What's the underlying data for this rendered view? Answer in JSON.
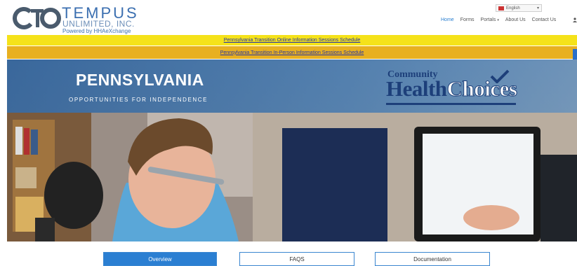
{
  "header": {
    "logo": {
      "mark_text": "CTO",
      "name": "TEMPUS",
      "subname": "UNLIMITED, INC.",
      "powered_by": "Powered by HHAeXchange"
    },
    "language": {
      "selected": "English",
      "icon": "us-flag-icon"
    },
    "nav": [
      {
        "label": "Home",
        "active": true,
        "has_dropdown": false
      },
      {
        "label": "Forms",
        "active": false,
        "has_dropdown": false
      },
      {
        "label": "Portals",
        "active": false,
        "has_dropdown": true
      },
      {
        "label": "About Us",
        "active": false,
        "has_dropdown": false
      },
      {
        "label": "Contact Us",
        "active": false,
        "has_dropdown": false
      }
    ],
    "user_icon": "user-icon"
  },
  "banners": [
    {
      "text": "Pennsylvania Transition Online Information Sessions Schedule",
      "color": "#f5e21a"
    },
    {
      "text": "Pennsylvania Transition In-Person Information Sessions Schedule",
      "color": "#e8b020"
    }
  ],
  "hero": {
    "title": "PENNSYLVANIA",
    "subtitle": "OPPORTUNITIES FOR INDEPENDENCE",
    "logo": {
      "community": "Community",
      "health": "Health",
      "choices": "Choices"
    }
  },
  "tabs": [
    {
      "label": "Overview",
      "active": true
    },
    {
      "label": "FAQS",
      "active": false
    },
    {
      "label": "Documentation",
      "active": false
    }
  ],
  "colors": {
    "accent": "#2b7fd2",
    "brand": "#3b6fb0",
    "chc_navy": "#1d3f7a"
  }
}
